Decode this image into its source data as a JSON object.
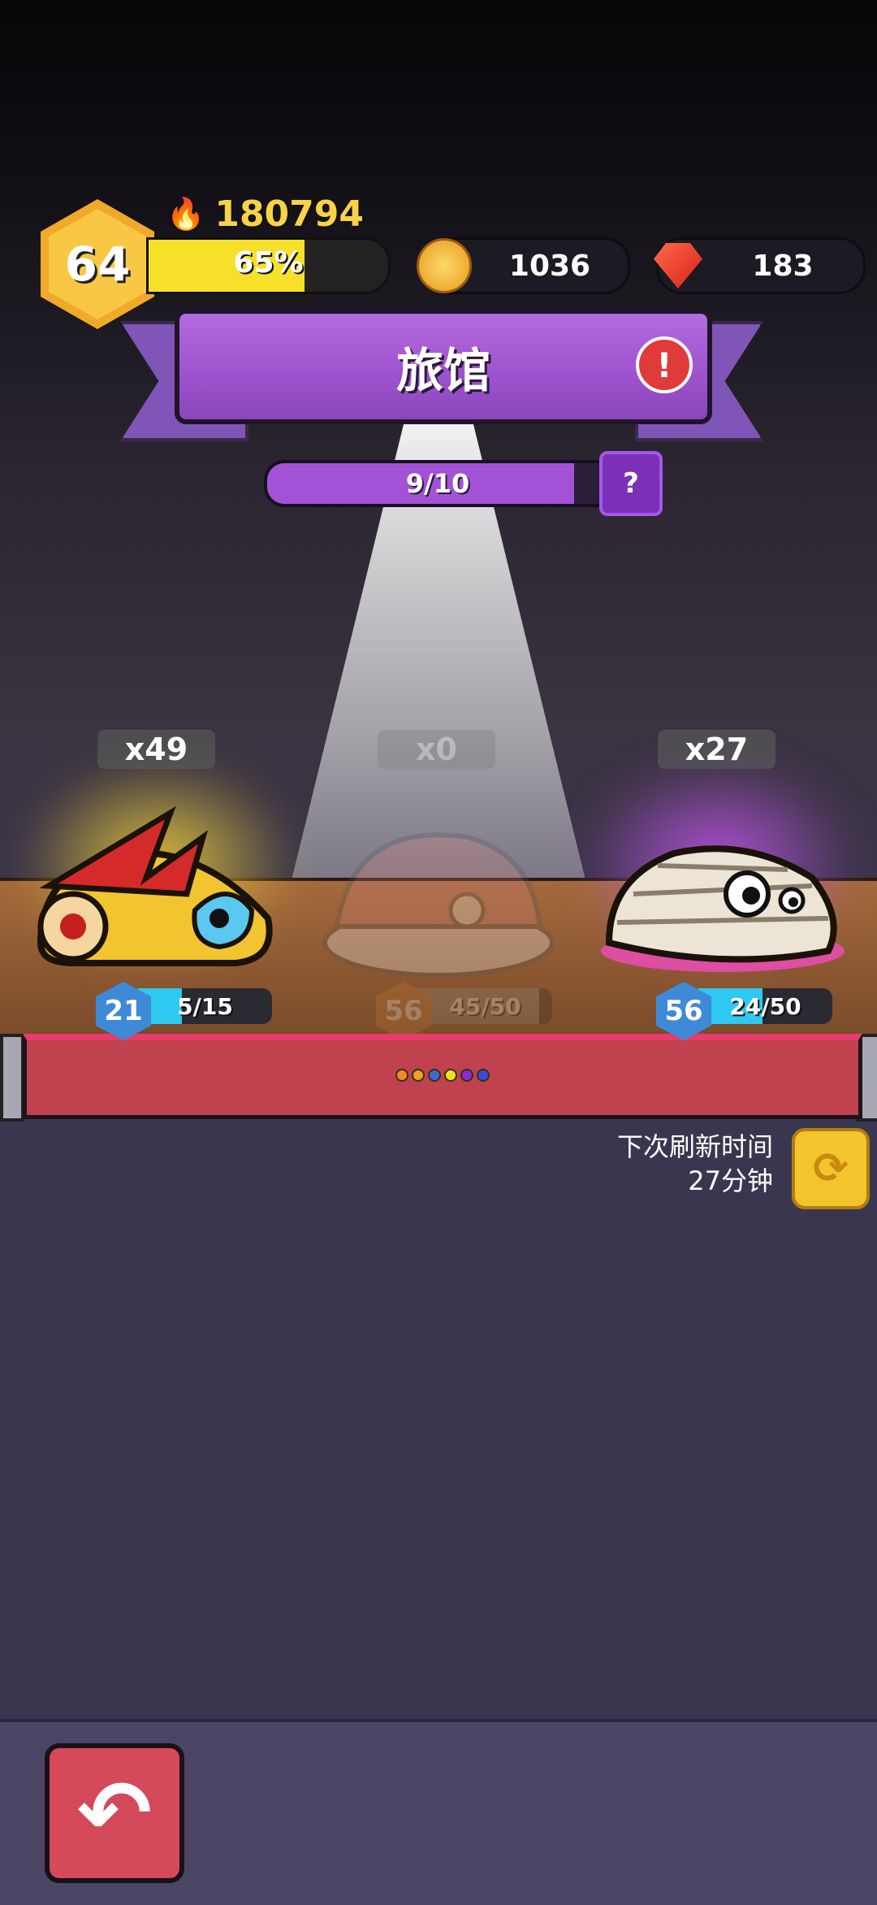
{
  "hud": {
    "level": "64",
    "power": "180794",
    "xp_percent_label": "65%",
    "xp_fraction": 0.65,
    "coins": "1036",
    "gems": "183"
  },
  "title": {
    "text": "旅馆",
    "alert_glyph": "!"
  },
  "slots_progress": {
    "label": "9/10",
    "fraction": 0.9,
    "help_glyph": "?"
  },
  "creatures": [
    {
      "count": "x49",
      "level": "21",
      "fragments": "5/15",
      "fraction": 0.33,
      "glow": "gold",
      "icon": "red-horned-slime-icon",
      "available": true
    },
    {
      "count": "x0",
      "level": "56",
      "fragments": "45/50",
      "fraction": 0.9,
      "glow": "none",
      "icon": "santa-hat-slime-icon",
      "available": false
    },
    {
      "count": "x27",
      "level": "56",
      "fragments": "24/50",
      "fraction": 0.48,
      "glow": "purple",
      "icon": "mummy-slime-icon",
      "available": true
    }
  ],
  "shelf": {
    "dot_colors": [
      "#f08a24",
      "#f0a020",
      "#3a6ad8",
      "#f0e020",
      "#8a2ad8",
      "#3a4ae0"
    ]
  },
  "refresh": {
    "line1": "下次刷新时间",
    "line2": "27分钟",
    "icon": "refresh-icon"
  },
  "nav": {
    "back_icon": "back-arrow-icon",
    "back_glyph": "↶"
  },
  "colors": {
    "accent_purple": "#a352d8",
    "shelf_red": "#c0424f",
    "gold": "#f4c42c"
  }
}
